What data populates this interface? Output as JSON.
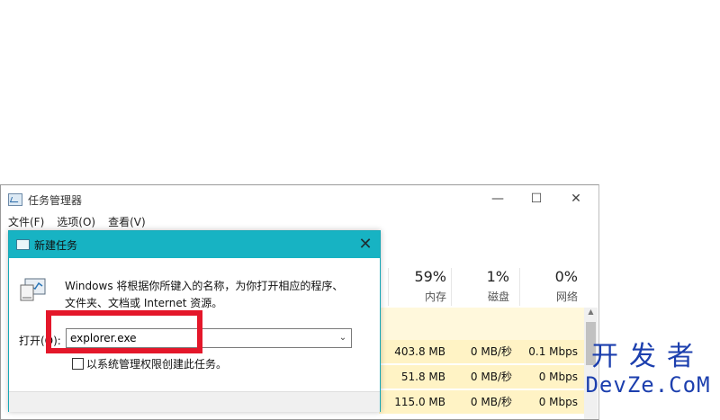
{
  "task_manager": {
    "title": "任务管理器",
    "window_controls": {
      "minimize": "—",
      "maximize": "☐",
      "close": "✕"
    },
    "menu": [
      "文件(F)",
      "选项(O)",
      "查看(V)"
    ],
    "columns": [
      {
        "percent": "59%",
        "label": "内存"
      },
      {
        "percent": "1%",
        "label": "磁盘"
      },
      {
        "percent": "0%",
        "label": "网络"
      }
    ],
    "rows": [
      {
        "memory": "403.8 MB",
        "disk": "0 MB/秒",
        "network": "0.1 Mbps"
      },
      {
        "memory": "51.8 MB",
        "disk": "0 MB/秒",
        "network": "0 Mbps"
      },
      {
        "memory": "115.0 MB",
        "disk": "0 MB/秒",
        "network": "0 Mbps"
      }
    ]
  },
  "dialog": {
    "title": "新建任务",
    "close_glyph": "✕",
    "description_line1": "Windows 将根据你所键入的名称，为你打开相应的程序、",
    "description_line2": "文件夹、文档或 Internet 资源。",
    "open_label": "打开(O):",
    "input_value": "explorer.exe",
    "dropdown_glyph": "⌄",
    "checkbox_label": "以系统管理权限创建此任务。",
    "checkbox_checked": false
  },
  "annotation": {
    "highlight_color": "#e4172a"
  },
  "watermark": {
    "line1": "开发者",
    "line2": "DevZe.CoM",
    "color": "#1c3fae"
  }
}
